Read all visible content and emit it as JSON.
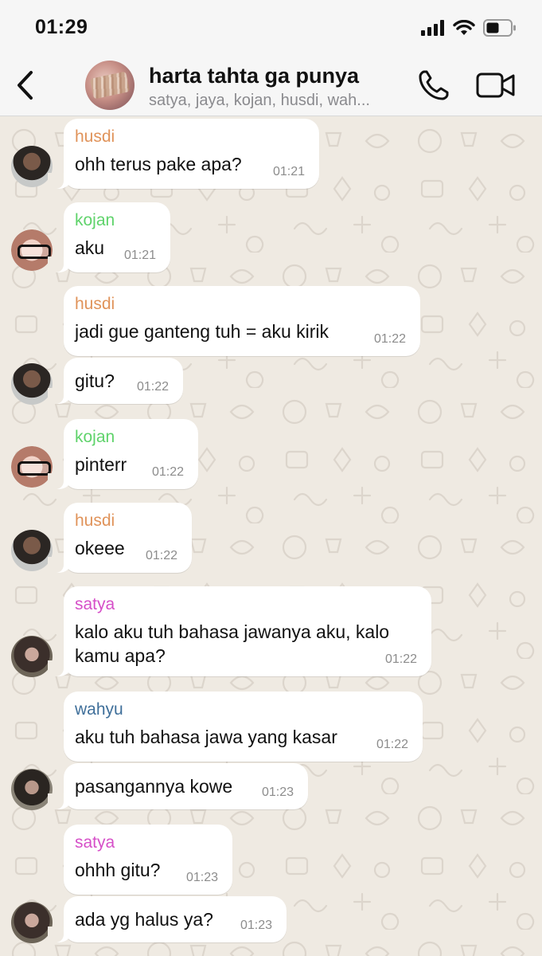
{
  "status_bar": {
    "time": "01:29"
  },
  "header": {
    "title": "harta tahta ga punya",
    "members": "satya, jaya, kojan, husdi, wah..."
  },
  "colors": {
    "husdi": "#e0935a",
    "kojan": "#5fd36b",
    "satya": "#d64fc8",
    "wahyu": "#3f6f9a"
  },
  "messages": [
    {
      "sender": "husdi",
      "text": "ohh terus pake apa?",
      "time": "01:21"
    },
    {
      "sender": "kojan",
      "text": "aku",
      "time": "01:21"
    },
    {
      "sender": "husdi",
      "text": "jadi gue ganteng tuh = aku kirik",
      "time": "01:22"
    },
    {
      "sender": "",
      "text": "gitu?",
      "time": "01:22"
    },
    {
      "sender": "kojan",
      "text": "pinterr",
      "time": "01:22"
    },
    {
      "sender": "husdi",
      "text": "okeee",
      "time": "01:22"
    },
    {
      "sender": "satya",
      "text": "kalo aku tuh bahasa jawanya aku, kalo kamu apa?",
      "time": "01:22"
    },
    {
      "sender": "wahyu",
      "text": "aku tuh bahasa jawa yang kasar",
      "time": "01:22"
    },
    {
      "sender": "",
      "text": "pasangannya kowe",
      "time": "01:23"
    },
    {
      "sender": "satya",
      "text": "ohhh gitu?",
      "time": "01:23"
    },
    {
      "sender": "",
      "text": "ada yg halus ya?",
      "time": "01:23"
    }
  ]
}
